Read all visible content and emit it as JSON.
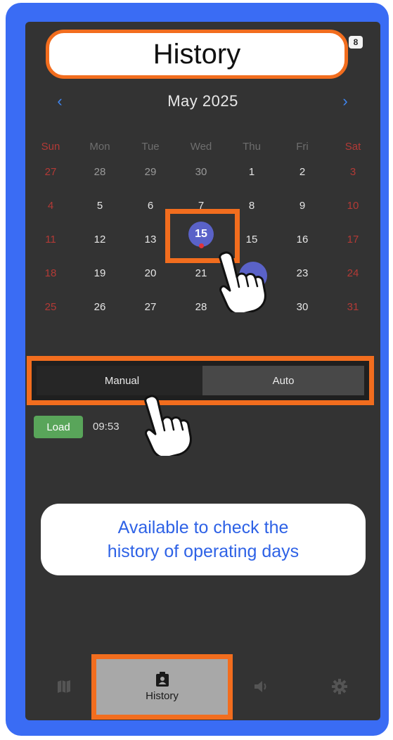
{
  "header": {
    "title": "History",
    "battery": "8"
  },
  "calendar": {
    "month_label": "May 2025",
    "prev_label": "‹",
    "next_label": "›",
    "weekdays": [
      "Sun",
      "Mon",
      "Tue",
      "Wed",
      "Thu",
      "Fri",
      "Sat"
    ],
    "selected_day": "15",
    "weeks": [
      [
        "27",
        "28",
        "29",
        "30",
        "1",
        "2",
        "3"
      ],
      [
        "4",
        "5",
        "6",
        "7",
        "8",
        "9",
        "10"
      ],
      [
        "11",
        "12",
        "13",
        "",
        "15",
        "16",
        "17"
      ],
      [
        "18",
        "19",
        "20",
        "21",
        "",
        "23",
        "24"
      ],
      [
        "25",
        "26",
        "27",
        "28",
        "",
        "30",
        "31"
      ]
    ]
  },
  "tabs": {
    "manual": "Manual",
    "auto": "Auto"
  },
  "entry": {
    "badge": "Load",
    "time": "09:53"
  },
  "callout": {
    "line1": "Available to check the",
    "line2": "history of operating days"
  },
  "nav": {
    "history_label": "History"
  },
  "colors": {
    "accent_orange": "#f26d1e",
    "frame_blue": "#3a6cf4",
    "selected": "#5a62c8",
    "load_green": "#59a55a"
  }
}
